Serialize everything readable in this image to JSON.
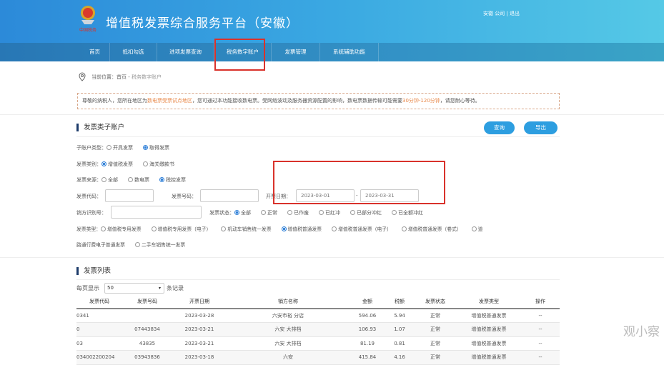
{
  "header": {
    "title": "增值税发票综合服务平台（安徽）",
    "user": "安徽            公司",
    "logout": "退出",
    "logo_text": "中国税务"
  },
  "nav": {
    "items": [
      {
        "label": "首页"
      },
      {
        "label": "抵扣勾选"
      },
      {
        "label": "进项发票查询"
      },
      {
        "label": "税务数字账户",
        "highlighted": true
      },
      {
        "label": "发票管理"
      },
      {
        "label": "系统辅助功能"
      }
    ]
  },
  "breadcrumb": {
    "prefix": "当前位置：",
    "home": "首页",
    "sep": " - ",
    "current": "税务数字账户"
  },
  "notice": {
    "part1": "尊敬的纳税人，您所在地区为",
    "highlight1": "数电票受票试点地区",
    "part2": "，您可通过本功能接收数电票。受网络波动及服务器资源配置的影响，数电票数据传输可能需要",
    "highlight2": "30分钟-120分钟",
    "part3": "，请您耐心等待。"
  },
  "filter": {
    "title": "发票类子账户",
    "query": "查询",
    "export": "导出",
    "subaccount": {
      "label": "子账户类型：",
      "options": [
        "开具发票",
        "取得发票"
      ],
      "selected": 1
    },
    "category": {
      "label": "发票类别：",
      "options": [
        "增值税发票",
        "海关缴款书"
      ],
      "selected": 0
    },
    "source": {
      "label": "发票来源：",
      "options": [
        "全部",
        "数电票",
        "税控发票"
      ],
      "selected": 2
    },
    "code_label": "发票代码：",
    "code_value": "",
    "number_label": "发票号码：",
    "number_value": "",
    "date_label": "开票日期：",
    "date_from": "2023-03-01",
    "date_sep": "-",
    "date_to": "2023-03-31",
    "seller_id_label": "销方识别号：",
    "seller_id_value": "",
    "status": {
      "label": "发票状态：",
      "options": [
        "全部",
        "正常",
        "已作废",
        "已红冲",
        "已部分冲红",
        "已全额冲红"
      ],
      "selected": 0
    },
    "type": {
      "label": "发票类型：",
      "options": [
        "增值税专用发票",
        "增值税专用发票（电子）",
        "机动车销售统一发票",
        "增值税普通发票",
        "增值税普通发票（电子）",
        "增值税普通发票（卷式）",
        "道路通行费电子普通发票",
        "二手车销售统一发票"
      ],
      "selected": 3,
      "wrap_part1": "道",
      "wrap_part2": "路通行费电子普通发票"
    }
  },
  "list": {
    "title": "发票列表",
    "per_page_label": "每页显示",
    "per_page": "50",
    "per_page_suffix": "条记录",
    "columns": [
      "发票代码",
      "发票号码",
      "开票日期",
      "销方名称",
      "金额",
      "税额",
      "发票状态",
      "发票类型",
      "操作"
    ],
    "rows": [
      [
        "0341",
        "",
        "2023-03-28",
        "六安市裕            分店",
        "594.06",
        "5.94",
        "正常",
        "增值税普通发票",
        "--"
      ],
      [
        "0",
        "07443834",
        "2023-03-21",
        "六安          大排档",
        "106.93",
        "1.07",
        "正常",
        "增值税普通发票",
        "--"
      ],
      [
        "03",
        "43835",
        "2023-03-21",
        "六安          大排档",
        "81.19",
        "0.81",
        "正常",
        "增值税普通发票",
        "--"
      ],
      [
        "034002200204",
        "03943836",
        "2023-03-18",
        "六安",
        "415.84",
        "4.16",
        "正常",
        "增值税普通发票",
        "--"
      ]
    ]
  },
  "watermark": "观小察"
}
